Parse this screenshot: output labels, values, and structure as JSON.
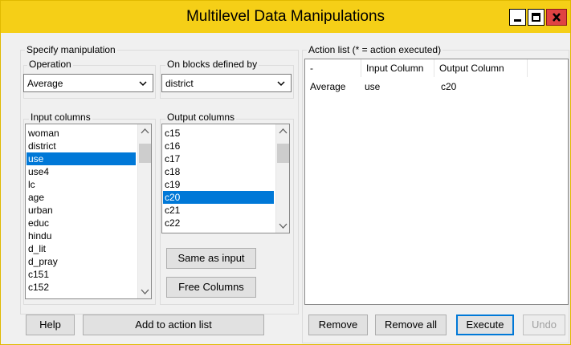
{
  "window": {
    "title": "Multilevel Data Manipulations",
    "title_bar_color": "#f5cf17",
    "controls": [
      "minimize-icon",
      "maximize-icon",
      "close-icon"
    ]
  },
  "specify": {
    "group_label": "Specify manipulation",
    "operation_label": "Operation",
    "operation_value": "Average",
    "blocks_label": "On blocks defined by",
    "blocks_value": "district",
    "input_columns_label": "Input columns",
    "input_columns": [
      "woman",
      "district",
      "use",
      "use4",
      "lc",
      "age",
      "urban",
      "educ",
      "hindu",
      "d_lit",
      "d_pray",
      "c151",
      "c152"
    ],
    "input_selected": "use",
    "output_columns_label": "Output columns",
    "output_columns": [
      "c15",
      "c16",
      "c17",
      "c18",
      "c19",
      "c20",
      "c21",
      "c22"
    ],
    "output_selected": "c20",
    "same_as_input": "Same as input",
    "free_columns": "Free Columns"
  },
  "action_list": {
    "group_label": "Action list (* = action executed)",
    "headers": [
      "-",
      "Input Column",
      "Output Column"
    ],
    "rows": [
      {
        "operation": "Average",
        "input": "use",
        "output": "c20"
      }
    ]
  },
  "buttons": {
    "help": "Help",
    "add": "Add to action list",
    "remove": "Remove",
    "remove_all": "Remove all",
    "execute": "Execute",
    "undo": "Undo"
  },
  "colors": {
    "selection": "#0078d7"
  }
}
